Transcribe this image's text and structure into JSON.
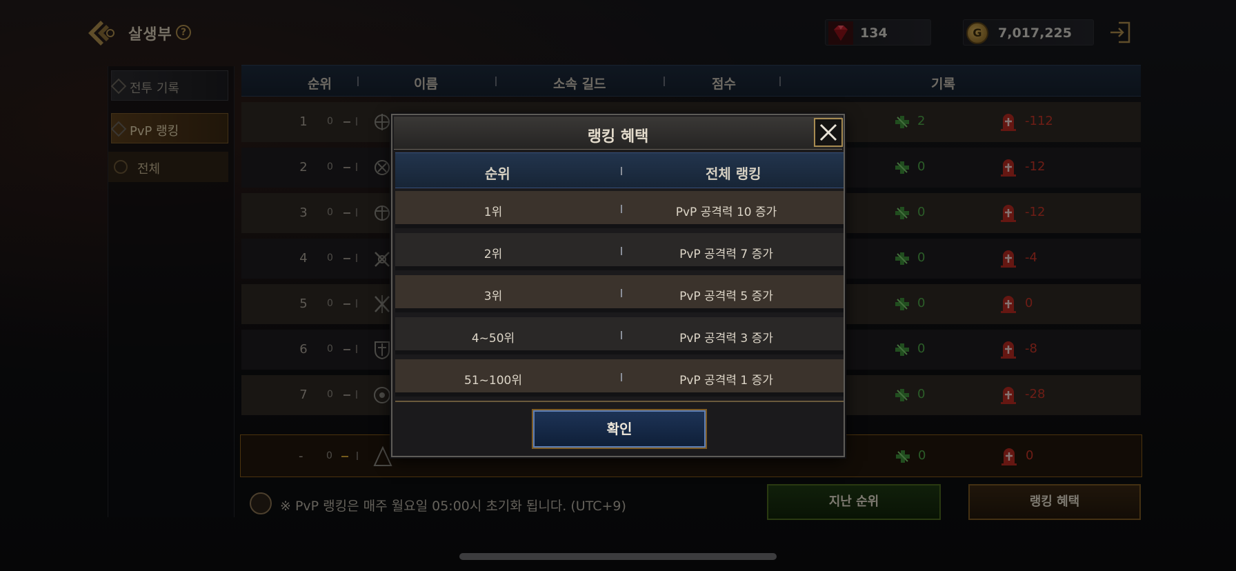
{
  "header": {
    "title": "살생부",
    "help": "?",
    "ruby": "134",
    "gold": "7,017,225"
  },
  "sidebar": {
    "items": [
      {
        "label": "전투 기록"
      },
      {
        "label": "PvP 랭킹"
      },
      {
        "label": "전체"
      }
    ]
  },
  "table": {
    "columns": [
      "순위",
      "이름",
      "소속 길드",
      "점수",
      "기록"
    ],
    "rows": [
      {
        "rank": "1",
        "move": "0",
        "wins": "2",
        "losses": "-112"
      },
      {
        "rank": "2",
        "move": "0",
        "wins": "0",
        "losses": "-12"
      },
      {
        "rank": "3",
        "move": "0",
        "wins": "0",
        "losses": "-12"
      },
      {
        "rank": "4",
        "move": "0",
        "wins": "0",
        "losses": "-4"
      },
      {
        "rank": "5",
        "move": "0",
        "wins": "0",
        "losses": "0"
      },
      {
        "rank": "6",
        "move": "0",
        "wins": "0",
        "losses": "-8"
      },
      {
        "rank": "7",
        "move": "0",
        "wins": "0",
        "losses": "-28"
      }
    ],
    "my_row": {
      "rank": "-",
      "move": "0",
      "wins": "0",
      "losses": "0"
    }
  },
  "notice": "※ PvP 랭킹은 매주 월요일 05:00시 초기화 됩니다. (UTC+9)",
  "buttons": {
    "prev_rank": "지난 순위",
    "ranking_reward": "랭킹 혜택"
  },
  "modal": {
    "title": "랭킹 혜택",
    "columns": [
      "순위",
      "전체 랭킹"
    ],
    "rows": [
      {
        "rank": "1위",
        "reward": "PvP 공격력 10 증가"
      },
      {
        "rank": "2위",
        "reward": "PvP 공격력 7 증가"
      },
      {
        "rank": "3위",
        "reward": "PvP 공격력 5 증가"
      },
      {
        "rank": "4~50위",
        "reward": "PvP 공격력 3 증가"
      },
      {
        "rank": "51~100위",
        "reward": "PvP 공격력 1 증가"
      }
    ],
    "confirm": "확인"
  },
  "colors": {
    "win": "#4fa94a",
    "loss": "#c83628",
    "accent_gold": "#b08f4e",
    "header_blue": "#1d2a3c"
  },
  "icons": [
    "back-arrow-icon",
    "help-icon",
    "ruby-icon",
    "gold-coin-icon",
    "exit-icon",
    "guild-emblem-icon",
    "win-icon",
    "loss-icon",
    "close-icon",
    "notice-icon"
  ]
}
